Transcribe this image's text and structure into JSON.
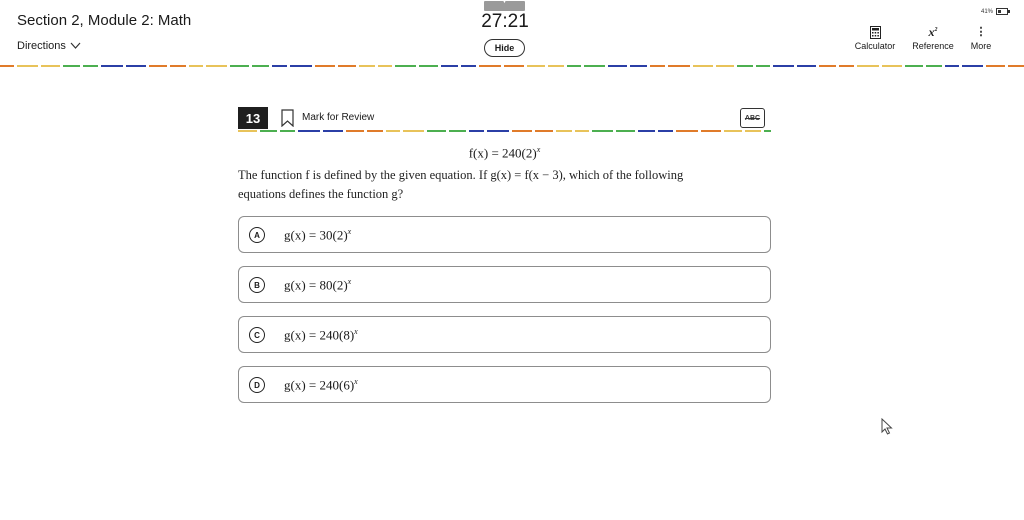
{
  "header": {
    "section_title": "Section 2, Module 2: Math",
    "directions_label": "Directions",
    "timer": "27:21",
    "hide_label": "Hide",
    "battery_text": "41%",
    "tools": {
      "calculator_label": "Calculator",
      "reference_label": "Reference",
      "more_label": "More"
    }
  },
  "question": {
    "number": "13",
    "mark_for_review_label": "Mark for Review",
    "abc_label": "ABC",
    "formula": "f(x) = 240(2)",
    "formula_exponent": "x",
    "prompt_line1": "The function f is defined by the given equation. If g(x) = f(x − 3), which of the following",
    "prompt_line2": "equations defines the function g?",
    "choices": [
      {
        "letter": "A",
        "text": "g(x) = 30(2)",
        "exponent": "x"
      },
      {
        "letter": "B",
        "text": "g(x) = 80(2)",
        "exponent": "x"
      },
      {
        "letter": "C",
        "text": "g(x) = 240(8)",
        "exponent": "x"
      },
      {
        "letter": "D",
        "text": "g(x) = 240(6)",
        "exponent": "x"
      }
    ]
  },
  "colors": {
    "dash_orange": "#e07b2a",
    "dash_blue": "#2b3fa6",
    "dash_green": "#4caf50",
    "dash_yellow": "#e8c35a"
  }
}
